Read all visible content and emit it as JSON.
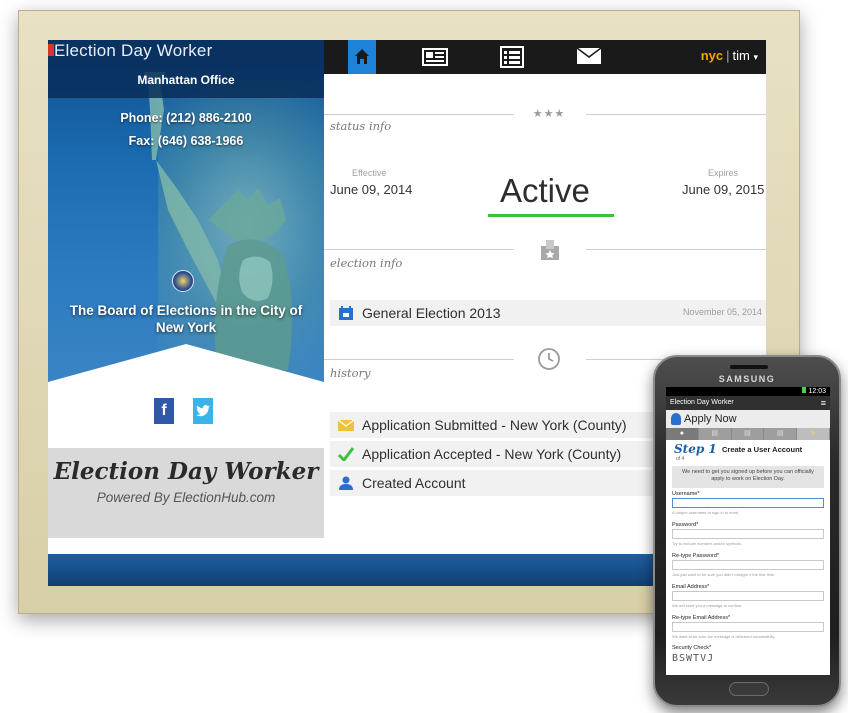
{
  "app": {
    "title": "Election Day Worker",
    "office": "Manhattan Office",
    "phone_label": "Phone:",
    "phone_number": "(212) 886-2100",
    "fax_label": "Fax:",
    "fax_number": "(646) 638-1966",
    "board_name": "The Board of Elections in the City of New York",
    "brand_title": "Election Day Worker",
    "brand_sub": "Powered By ElectionHub.com",
    "social": [
      {
        "name": "facebook-icon",
        "glyph": "f"
      },
      {
        "name": "twitter-icon",
        "glyph": "🐦"
      }
    ]
  },
  "nav": {
    "icons": [
      "home-icon",
      "newspaper-icon",
      "list-icon",
      "envelope-icon"
    ],
    "city": "nyc",
    "user": "tim",
    "caret": "▾"
  },
  "status": {
    "section_label": "status info",
    "section_icon": "★★★",
    "effective_label": "Effective",
    "effective_date": "June 09, 2014",
    "status_text": "Active",
    "expires_label": "Expires",
    "expires_date": "June 09, 2015"
  },
  "election": {
    "section_label": "election info",
    "item_label": "General Election 2013",
    "item_date": "November 05, 2014"
  },
  "history": {
    "section_label": "history",
    "items": [
      {
        "label": "Application Submitted - New York (County)",
        "icon": "envelope-icon",
        "color": "#f0c040"
      },
      {
        "label": "Application Accepted - New York (County)",
        "icon": "check-icon",
        "color": "#3fbf3f"
      },
      {
        "label": "Created Account",
        "icon": "user-icon",
        "color": "#2a6fc8"
      }
    ]
  },
  "phone": {
    "brand": "SAMSUNG",
    "time": "12:03",
    "app_title": "Election Day Worker",
    "apply": "Apply Now",
    "step": "Step 1",
    "step_of": "of 4",
    "step_title": "Create a User Account",
    "note": "We need to get you signed up before you can officially apply to work on Election Day.",
    "fields": [
      {
        "label": "Username*",
        "hint": "A unique username to sign in to ednb."
      },
      {
        "label": "Password*",
        "hint": "Try to include numbers and/or symbols."
      },
      {
        "label": "Re-type Password*",
        "hint": "Just just want to be sure you didn't mistype it the first time."
      },
      {
        "label": "Email Address*",
        "hint": "We will send you a message to confirm."
      },
      {
        "label": "Re-type Email Address*",
        "hint": "We want to be sure the message is delivered successfully."
      }
    ],
    "security_label": "Security Check*",
    "captcha": "BSWTVJ"
  }
}
